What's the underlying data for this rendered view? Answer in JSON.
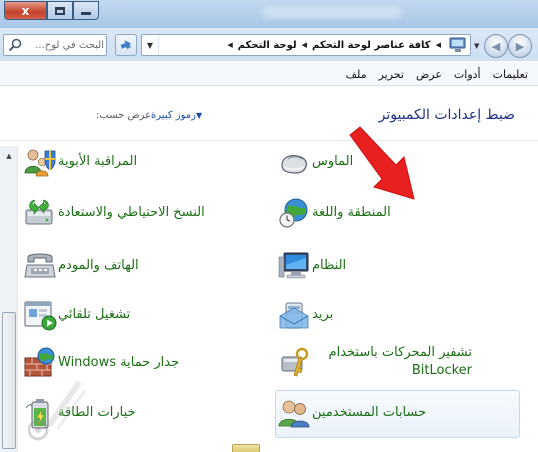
{
  "window": {
    "close_glyph": "x"
  },
  "address_bar": {
    "search_placeholder": "البحث في لوح...",
    "breadcrumbs": [
      "لوحة التحكم",
      "كافة عناصر لوحة التحكم"
    ]
  },
  "menu": {
    "items": [
      "ملف",
      "تحرير",
      "عرض",
      "أدوات",
      "تعليمات"
    ]
  },
  "content": {
    "title": "ضبط إعدادات الكمبيوتر",
    "view_by_label": "عرض حسب:",
    "view_by_value": "رموز كبيرة"
  },
  "items": {
    "mouse": "الماوس",
    "parental_controls": "المراقبة الأبوية",
    "region_language": "المنطقة واللغة",
    "backup_restore": "النسخ الاحتياطي والاستعادة",
    "system": "النظام",
    "phone_modem": "الهاتف والمودم",
    "mail": "بريد",
    "autoplay": "تشغيل تلقائي",
    "bitlocker": "تشفير المحركات باستخدام BitLocker",
    "firewall": "جدار حماية Windows",
    "user_accounts": "حسابات المستخدمين",
    "power_options": "خيارات الطاقة"
  },
  "colors": {
    "link_green": "#1b6e14",
    "heading_blue": "#1e3287",
    "arrow_red": "#e8201f"
  }
}
